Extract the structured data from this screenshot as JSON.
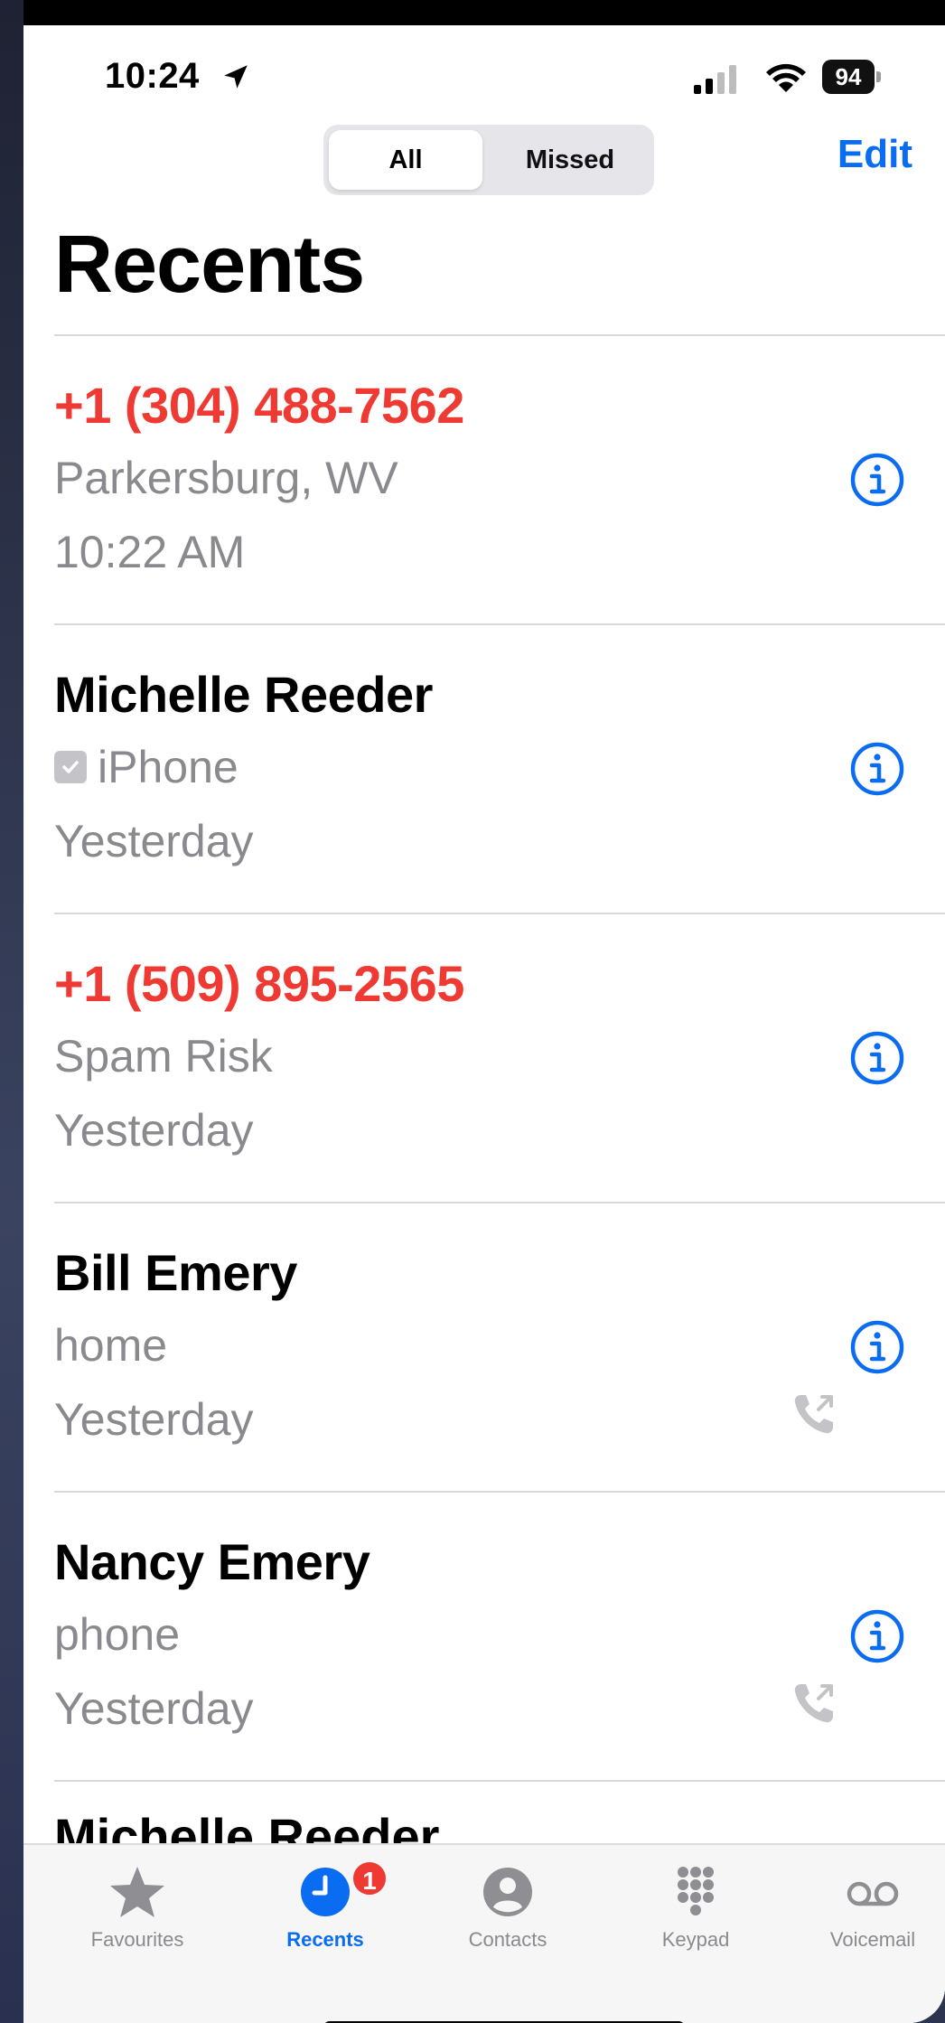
{
  "status_bar": {
    "time": "10:24",
    "battery": "94"
  },
  "segmented": {
    "all_label": "All",
    "missed_label": "Missed"
  },
  "header": {
    "edit_label": "Edit",
    "title": "Recents"
  },
  "calls": [
    {
      "name": "+1 (304) 488-7562",
      "missed": true,
      "subtitle": "Parkersburg, WV",
      "time": "10:22 AM",
      "outgoing": false,
      "checked_device": false
    },
    {
      "name": "Michelle Reeder",
      "missed": false,
      "subtitle": "iPhone",
      "time": "Yesterday",
      "outgoing": false,
      "checked_device": true
    },
    {
      "name": "+1 (509) 895-2565",
      "missed": true,
      "subtitle": "Spam Risk",
      "time": "Yesterday",
      "outgoing": false,
      "checked_device": false
    },
    {
      "name": "Bill Emery",
      "missed": false,
      "subtitle": "home",
      "time": "Yesterday",
      "outgoing": true,
      "checked_device": false
    },
    {
      "name": "Nancy Emery",
      "missed": false,
      "subtitle": "phone",
      "time": "Yesterday",
      "outgoing": true,
      "checked_device": false
    }
  ],
  "partial_row": {
    "name": "Michelle Reeder"
  },
  "tabbar": {
    "items": [
      {
        "label": "Favourites",
        "icon": "star-icon",
        "active": false
      },
      {
        "label": "Recents",
        "icon": "clock-icon",
        "active": true,
        "badge": "1"
      },
      {
        "label": "Contacts",
        "icon": "person-circle-icon",
        "active": false
      },
      {
        "label": "Keypad",
        "icon": "keypad-icon",
        "active": false
      },
      {
        "label": "Voicemail",
        "icon": "voicemail-icon",
        "active": false
      }
    ]
  },
  "colors": {
    "accent": "#0a6cf0",
    "missed": "#ef3a33",
    "secondary_text": "#8a8a8e"
  }
}
